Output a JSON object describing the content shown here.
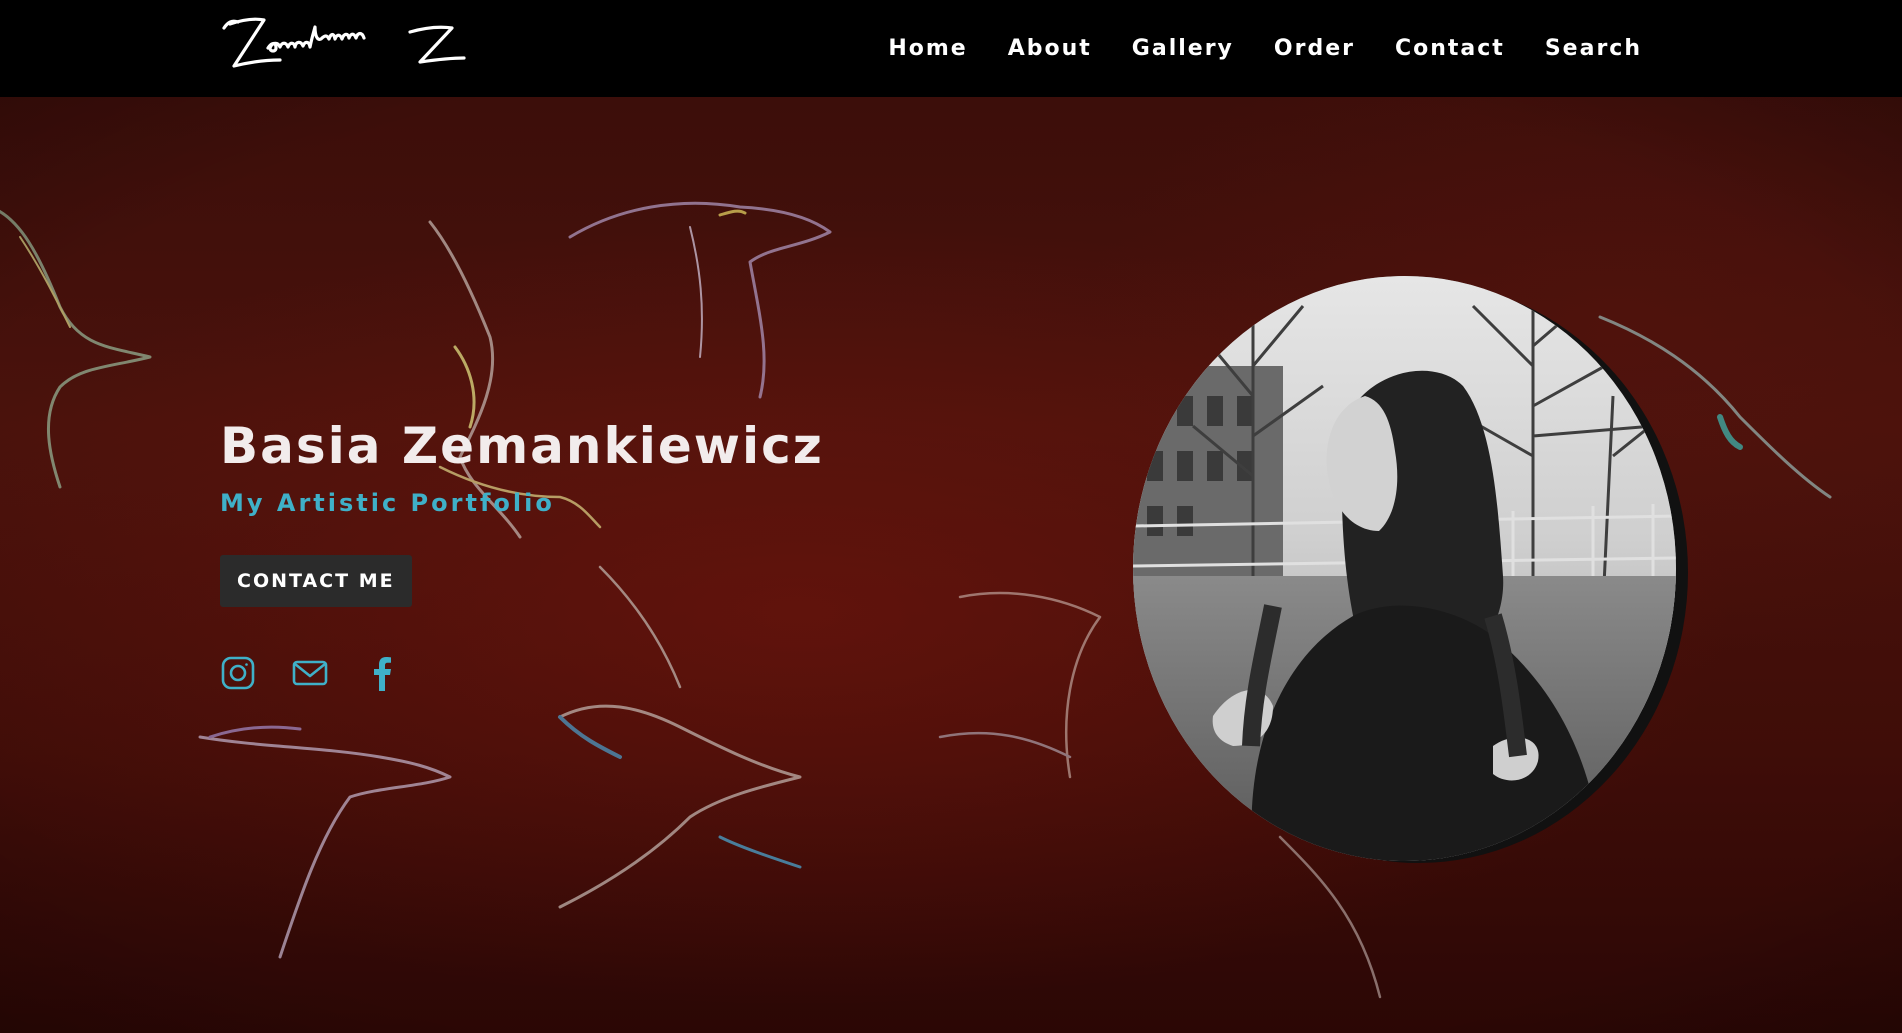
{
  "header": {
    "logo_text": "ZemankiewicZ",
    "nav": [
      {
        "label": "Home"
      },
      {
        "label": "About"
      },
      {
        "label": "Gallery"
      },
      {
        "label": "Order"
      },
      {
        "label": "Contact"
      },
      {
        "label": "Search"
      }
    ]
  },
  "hero": {
    "title": "Basia Zemankiewicz",
    "subtitle": "My Artistic Portfolio",
    "cta_label": "CONTACT ME",
    "socials": [
      {
        "icon": "instagram-icon"
      },
      {
        "icon": "envelope-icon"
      },
      {
        "icon": "facebook-icon"
      }
    ],
    "portrait_alt": "black-and-white portrait photo"
  },
  "colors": {
    "nav_bg": "#000000",
    "hero_bg": "#3c0e0a",
    "accent": "#3fb0c8",
    "button_bg": "#2b2b2b",
    "title": "#f2ecec"
  }
}
